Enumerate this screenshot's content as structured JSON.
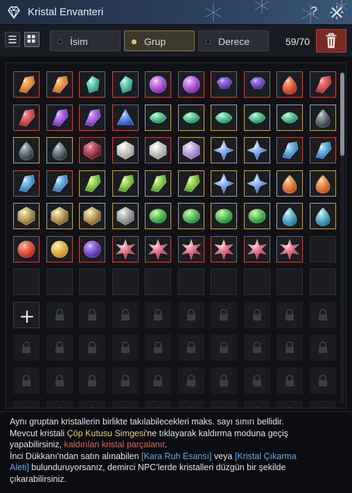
{
  "window": {
    "title": "Kristal Envanteri",
    "help_label": "?"
  },
  "toolbar": {
    "filters": [
      {
        "label": "İsim",
        "active": false
      },
      {
        "label": "Grup",
        "active": true
      },
      {
        "label": "Derece",
        "active": false
      }
    ],
    "count": "59/70"
  },
  "inventory": {
    "rows": [
      [
        "orange-shard",
        "orange-shard",
        "teal-shard",
        "teal-shard",
        "purple-orb",
        "purple-orb",
        "purple-hex",
        "purple-hex",
        "red-drop",
        "red-shard"
      ],
      [
        "red-shard",
        "purple-shard",
        "purple-shard",
        "blue-tri",
        "green-marquise",
        "green-marquise",
        "green-marquise",
        "green-marquise",
        "green-marquise",
        "dark-drop"
      ],
      [
        "dark-drop",
        "dark-drop",
        "dark-red-cube",
        "white-cube",
        "white-cube",
        "purple-cube",
        "blue-star",
        "blue-star",
        "blue-shard",
        "blue-shard"
      ],
      [
        "blue-shard",
        "blue-shard",
        "green-shard",
        "green-shard",
        "green-shard",
        "green-shard",
        "blue-star",
        "blue-star",
        "orange-drop",
        "orange-drop"
      ],
      [
        "gold-cube",
        "gold-cube",
        "gold-cube",
        "gray-cube",
        "green-gem",
        "green-gem",
        "green-gem",
        "green-gem",
        "cyan-drop",
        "cyan-drop"
      ],
      [
        "red-orb",
        "gold-orb",
        "purple-orb-small",
        "red-flower",
        "red-flower",
        "red-flower",
        "red-flower",
        "red-flower",
        "red-flower",
        "empty"
      ]
    ],
    "add_slot_icon": "plus-icon",
    "lock_icon": "lock-icon"
  },
  "info": {
    "line1": "Aynı gruptan kristallerin birlikte takılabilecekleri maks. sayı sınırı bellidir.",
    "line2a": "Mevcut kristali ",
    "line2b": "Çöp Kutusu Simgesi",
    "line2c": "'ne tıklayarak kaldırma moduna geçiş",
    "line3a": "yapabilirsiniz, ",
    "line3b": "kaldırılan kristal parçalanır",
    "line3c": ".",
    "line4a": "İnci Dükkanı'ndan satın alınabilen ",
    "line4b": "[Kara Ruh Esansı]",
    "line4c": " veya ",
    "line4d": "[Kristal Çıkarma",
    "line5a": "Aleti]",
    "line5b": " bulunduruyorsanız, demirci NPC'lerde kristalleri düzgün bir şekilde",
    "line6": "çıkarabilirsiniz."
  },
  "colors": {
    "accent": "#e8c15a",
    "trash_bg": "#7a2a22",
    "frame_red": "#c44b3a",
    "frame_yellow": "#c9a83d"
  }
}
